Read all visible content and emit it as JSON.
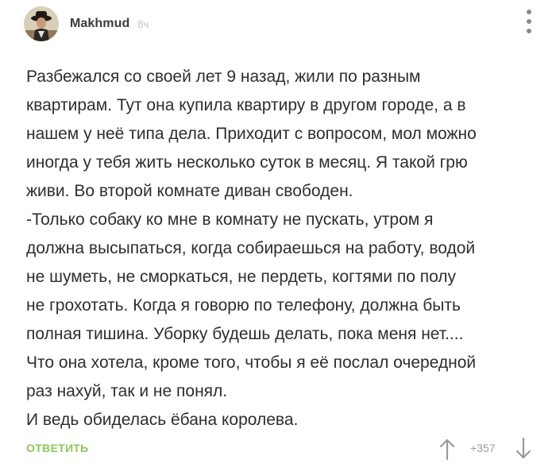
{
  "comment": {
    "author": "Makhmud",
    "time": "8ч",
    "avatar_icon": "user-avatar",
    "menu_icon": "more-vertical-icon",
    "lines": [
      "Разбежался со своей лет 9 назад, жили по разным",
      "квартирам. Тут она купила квартиру в другом городе, а в",
      "нашем у неё типа дела. Приходит с вопросом, мол можно",
      "иногда у тебя жить несколько суток в месяц. Я такой грю",
      "живи. Во второй комнате диван свободен.",
      "-Только собаку ко мне в комнату не пускать, утром я",
      "должна высыпаться, когда собираешься на работу, водой",
      "не шуметь, не сморкаться, не пердеть, когтями по полу",
      "не грохотать. Когда я говорю по телефону, должна быть",
      "полная тишина. Уборку будешь делать, пока меня нет....",
      "Что она хотела, кроме того, чтобы я её послал очередной",
      "раз нахуй, так и не понял.",
      "И ведь обиделась ёбана королева."
    ]
  },
  "footer": {
    "reply_label": "ОТВЕТИТЬ",
    "score": "+357",
    "upvote_icon": "arrow-up-icon",
    "downvote_icon": "arrow-down-icon"
  },
  "colors": {
    "accent_green": "#8ac858",
    "text": "#2e2e2e",
    "muted": "#9a9a9a"
  }
}
